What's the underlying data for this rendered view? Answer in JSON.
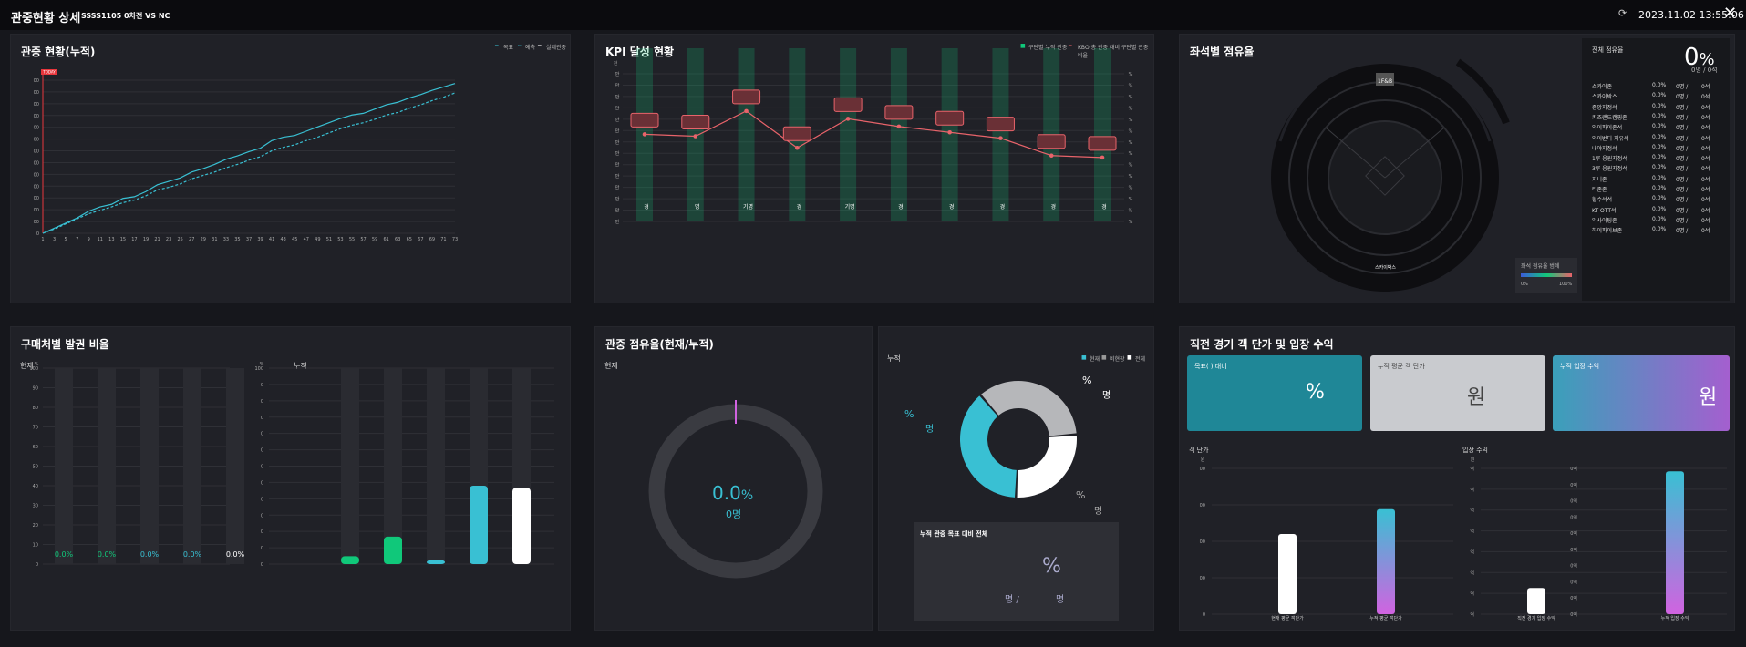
{
  "header": {
    "title": "관중현황 상세",
    "subtitle": "SSSS1105 0차전 VS NC",
    "refresh_icon": "refresh-icon",
    "datetime": "2023.11.02 13:55:06",
    "close_icon": "close-icon"
  },
  "cumulative": {
    "title": "관중 현황(누적)",
    "legend": [
      "목표",
      "예측",
      "실제관중"
    ],
    "today_badge": "TODAY",
    "y_ticks": [
      "00",
      "00",
      "00",
      "00",
      "00",
      "00",
      "00",
      "00",
      "00",
      "00",
      "00",
      "00",
      "00",
      "0"
    ],
    "chart_data": {
      "type": "line",
      "x": [
        1,
        3,
        5,
        7,
        9,
        11,
        13,
        15,
        17,
        19,
        21,
        23,
        25,
        27,
        29,
        31,
        33,
        35,
        37,
        39,
        41,
        43,
        45,
        47,
        49,
        51,
        53,
        55,
        57,
        59,
        61,
        63,
        65,
        67,
        69,
        71,
        73
      ],
      "series": [
        {
          "name": "목표",
          "values": [
            0,
            0.3,
            0.6,
            0.9,
            1.3,
            1.55,
            1.7,
            2.05,
            2.15,
            2.45,
            2.85,
            3.05,
            3.25,
            3.6,
            3.8,
            4.05,
            4.35,
            4.55,
            4.8,
            5.0,
            5.45,
            5.65,
            5.75,
            6.0,
            6.25,
            6.5,
            6.75,
            6.95,
            7.05,
            7.3,
            7.55,
            7.7,
            7.95,
            8.15,
            8.4,
            8.6,
            8.8
          ]
        },
        {
          "name": "예측",
          "values": [
            0,
            0.25,
            0.55,
            0.85,
            1.15,
            1.35,
            1.55,
            1.8,
            1.95,
            2.2,
            2.55,
            2.7,
            2.9,
            3.2,
            3.4,
            3.6,
            3.85,
            4.05,
            4.3,
            4.5,
            4.85,
            5.05,
            5.2,
            5.45,
            5.65,
            5.9,
            6.15,
            6.35,
            6.5,
            6.7,
            6.95,
            7.1,
            7.35,
            7.55,
            7.8,
            8.0,
            8.25
          ]
        }
      ]
    }
  },
  "kpi": {
    "title": "KPI 달성 현황",
    "legend": [
      "구단별 누적 관중",
      "KBO 총 관중 대비 구단별 관중 비율"
    ],
    "left_ticks": [
      "만",
      "만",
      "만",
      "만",
      "만",
      "만",
      "만",
      "만",
      "만",
      "만",
      "만",
      "만",
      "만",
      "만"
    ],
    "left_top": "천",
    "right_ticks": [
      "%",
      "%",
      "%",
      "%",
      "%",
      "%",
      "%",
      "%",
      "%",
      "%",
      "%",
      "%",
      "%",
      "%"
    ],
    "x_labels": [
      "경",
      "명",
      "기명",
      "경",
      "기명",
      "경",
      "경",
      "경",
      "경",
      "경"
    ],
    "chart_data": {
      "type": "bar",
      "categories": [
        "1",
        "2",
        "3",
        "4",
        "5",
        "6",
        "7",
        "8",
        "9",
        "10"
      ],
      "series": [
        {
          "name": "구단별 누적 관중",
          "values": [
            1,
            1,
            1,
            1,
            1,
            1,
            1,
            1,
            1,
            1
          ]
        },
        {
          "name": "KBO 총 관중 대비 구단별 관중 비율",
          "values": [
            4.5,
            4.4,
            5.7,
            3.8,
            5.3,
            4.9,
            4.6,
            4.3,
            3.4,
            3.3
          ]
        }
      ]
    }
  },
  "seats": {
    "title": "좌석별 점유율",
    "total_label": "전체 점유율",
    "total_pct": "0",
    "pct_sign": "%",
    "total_sub": "0명 / 0석",
    "top_label": "1F&B",
    "bottom_label": "스카이박스",
    "rows": [
      [
        "스카이존",
        "0.0%",
        "0명 /",
        "0석"
      ],
      [
        "스카이박스",
        "0.0%",
        "0명 /",
        "0석"
      ],
      [
        "중앙지정석",
        "0.0%",
        "0명 /",
        "0석"
      ],
      [
        "키즈랜드캠핑존",
        "0.0%",
        "0명 /",
        "0석"
      ],
      [
        "와이파이존석",
        "0.0%",
        "0명 /",
        "0석"
      ],
      [
        "와이번디 지유석",
        "0.0%",
        "0명 /",
        "0석"
      ],
      [
        "내야지정석",
        "0.0%",
        "0명 /",
        "0석"
      ],
      [
        "1루 응원지정석",
        "0.0%",
        "0명 /",
        "0석"
      ],
      [
        "3루 응원지정석",
        "0.0%",
        "0명 /",
        "0석"
      ],
      [
        "지니존",
        "0.0%",
        "0명 /",
        "0석"
      ],
      [
        "티존존",
        "0.0%",
        "0명 /",
        "0석"
      ],
      [
        "협수석석",
        "0.0%",
        "0명 /",
        "0석"
      ],
      [
        "KT OTT석",
        "0.0%",
        "0명 /",
        "0석"
      ],
      [
        "익사이팅존",
        "0.0%",
        "0명 /",
        "0석"
      ],
      [
        "하이파이브존",
        "0.0%",
        "0명 /",
        "0석"
      ]
    ],
    "legend_title": "좌석 점유율 범례",
    "legend_min": "0%",
    "legend_max": "100%"
  },
  "purchase": {
    "title": "구매처별 발권 비율",
    "current_label": "현재",
    "cumulative_label": "누적",
    "pct_unit": "%",
    "y_ticks": [
      "100",
      "90",
      "80",
      "70",
      "60",
      "50",
      "40",
      "30",
      "20",
      "10",
      "0"
    ],
    "y_ticks_right": [
      "100",
      "0",
      "0",
      "0",
      "0",
      "0",
      "0",
      "0",
      "0",
      "0",
      "0",
      "0",
      "0"
    ],
    "current_values": [
      "0.0%",
      "0.0%",
      "0.0%",
      "0.0%",
      "0.0%"
    ],
    "chart_data": {
      "type": "bar",
      "categories": [
        "1",
        "2",
        "3",
        "4",
        "5"
      ],
      "series": [
        {
          "name": "현재",
          "values": [
            0,
            0,
            0,
            0,
            0
          ]
        },
        {
          "name": "누적",
          "values": [
            4,
            14,
            2,
            40,
            39
          ]
        }
      ]
    }
  },
  "share": {
    "title": "관중 점유율(현재/누적)",
    "current_label": "현재",
    "current_pct": "0.0",
    "pct_sign": "%",
    "current_count": "0명",
    "cumulative_label": "누적",
    "legend": [
      "현재",
      "비현장",
      "전체"
    ],
    "labels": {
      "p1": "%",
      "c1": "명",
      "p2": "%",
      "c2": "명",
      "p3": "%",
      "c3": "명"
    },
    "chart_data": {
      "type": "pie",
      "labels": [
        "현재",
        "비현장",
        "전체"
      ],
      "values": [
        38,
        35,
        27
      ]
    },
    "goal": {
      "title": "누적 관중 목표 대비 전체",
      "pct": "%",
      "line": "명 /",
      "line2": "명"
    }
  },
  "revenue": {
    "title": "직전 경기 객 단가 및 입장 수익",
    "cards": [
      {
        "label": "목표(  ) 대비",
        "value": "%"
      },
      {
        "label": "누적 평균 객 단가",
        "value": "원"
      },
      {
        "label": "누적 입장 수익",
        "value": "원"
      }
    ],
    "left": {
      "title": "객 단가",
      "unit": "원",
      "ticks": [
        "00",
        "00",
        "00",
        "00",
        "0"
      ],
      "labels": [
        "현재 평균 객단가",
        "누적 평균 객단가"
      ]
    },
    "mid": {
      "title": "입장 수익",
      "unit": "원",
      "ticks": [
        "억",
        "억",
        "억",
        "억",
        "억",
        "억",
        "억",
        "억"
      ],
      "label": "직전 경기 입장 수익"
    },
    "right": {
      "ticks": [
        "0억",
        "0억",
        "0억",
        "0억",
        "0억",
        "0억",
        "0억",
        "0억",
        "0억",
        "0억"
      ],
      "label": "누적 입장 수익"
    },
    "chart_data": [
      {
        "type": "bar",
        "categories": [
          "현재 평균 객단가",
          "누적 평균 객단가"
        ],
        "values": [
          55,
          72
        ]
      },
      {
        "type": "bar",
        "categories": [
          "직전 경기 입장 수익",
          "누적 입장 수익"
        ],
        "values": [
          18,
          98
        ]
      }
    ]
  },
  "colors": {
    "accent": "#39c0d3",
    "green": "#10c87a",
    "red": "#e8636a",
    "purple": "#d163e0"
  }
}
